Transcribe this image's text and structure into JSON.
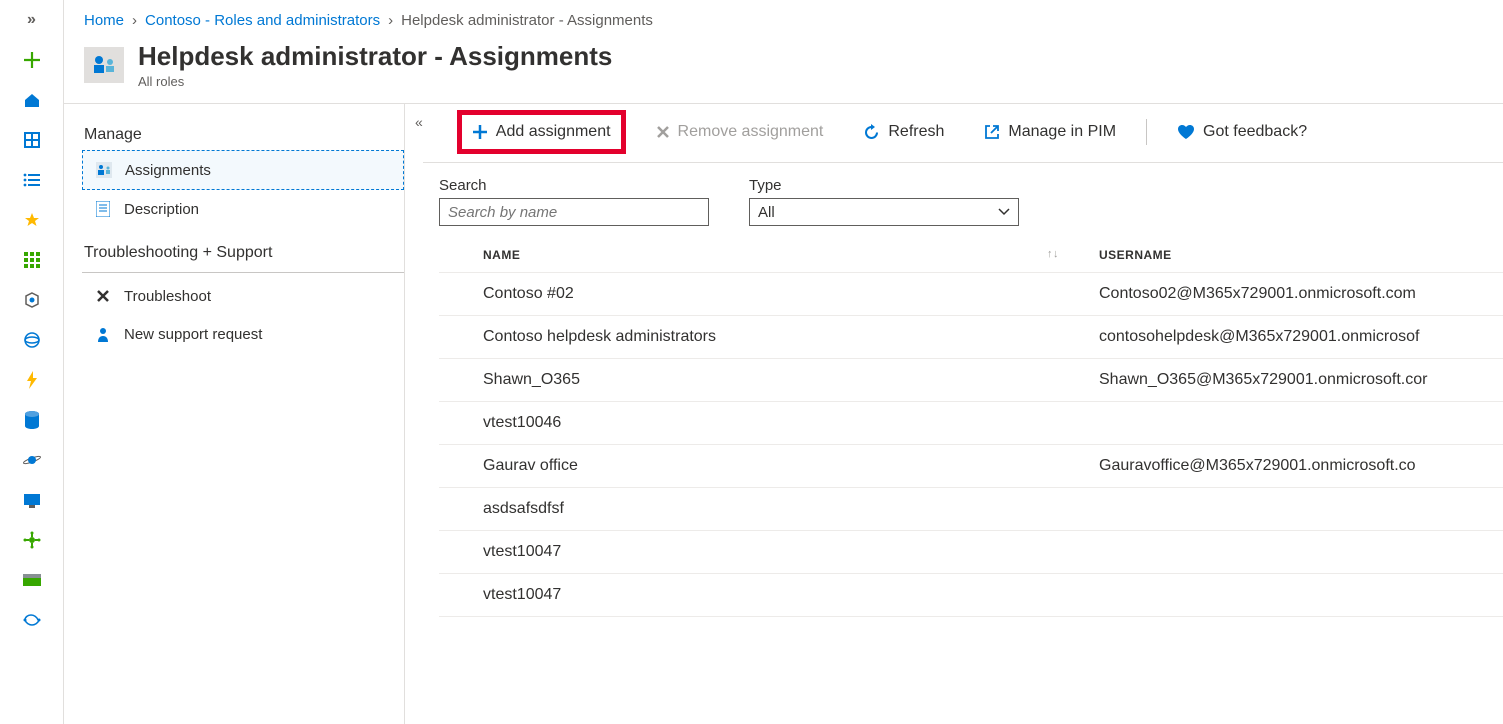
{
  "breadcrumb": {
    "home": "Home",
    "parent": "Contoso - Roles and administrators",
    "current": "Helpdesk administrator - Assignments"
  },
  "header": {
    "title": "Helpdesk administrator - Assignments",
    "subtitle": "All roles"
  },
  "sidenav": {
    "manage": "Manage",
    "assignments": "Assignments",
    "description": "Description",
    "troubleshooting": "Troubleshooting + Support",
    "troubleshoot": "Troubleshoot",
    "new_support": "New support request"
  },
  "toolbar": {
    "add": "Add assignment",
    "remove": "Remove assignment",
    "refresh": "Refresh",
    "manage_pim": "Manage in PIM",
    "feedback": "Got feedback?"
  },
  "filters": {
    "search_label": "Search",
    "search_placeholder": "Search by name",
    "type_label": "Type",
    "type_value": "All"
  },
  "table": {
    "col_name": "NAME",
    "col_username": "USERNAME",
    "rows": [
      {
        "name": "Contoso #02",
        "username": "Contoso02@M365x729001.onmicrosoft.com"
      },
      {
        "name": "Contoso helpdesk administrators",
        "username": "contosohelpdesk@M365x729001.onmicrosof"
      },
      {
        "name": "Shawn_O365",
        "username": "Shawn_O365@M365x729001.onmicrosoft.cor"
      },
      {
        "name": "vtest10046",
        "username": ""
      },
      {
        "name": "Gaurav office",
        "username": "Gauravoffice@M365x729001.onmicrosoft.co"
      },
      {
        "name": "asdsafsdfsf",
        "username": ""
      },
      {
        "name": "vtest10047",
        "username": ""
      },
      {
        "name": "vtest10047",
        "username": ""
      }
    ]
  }
}
